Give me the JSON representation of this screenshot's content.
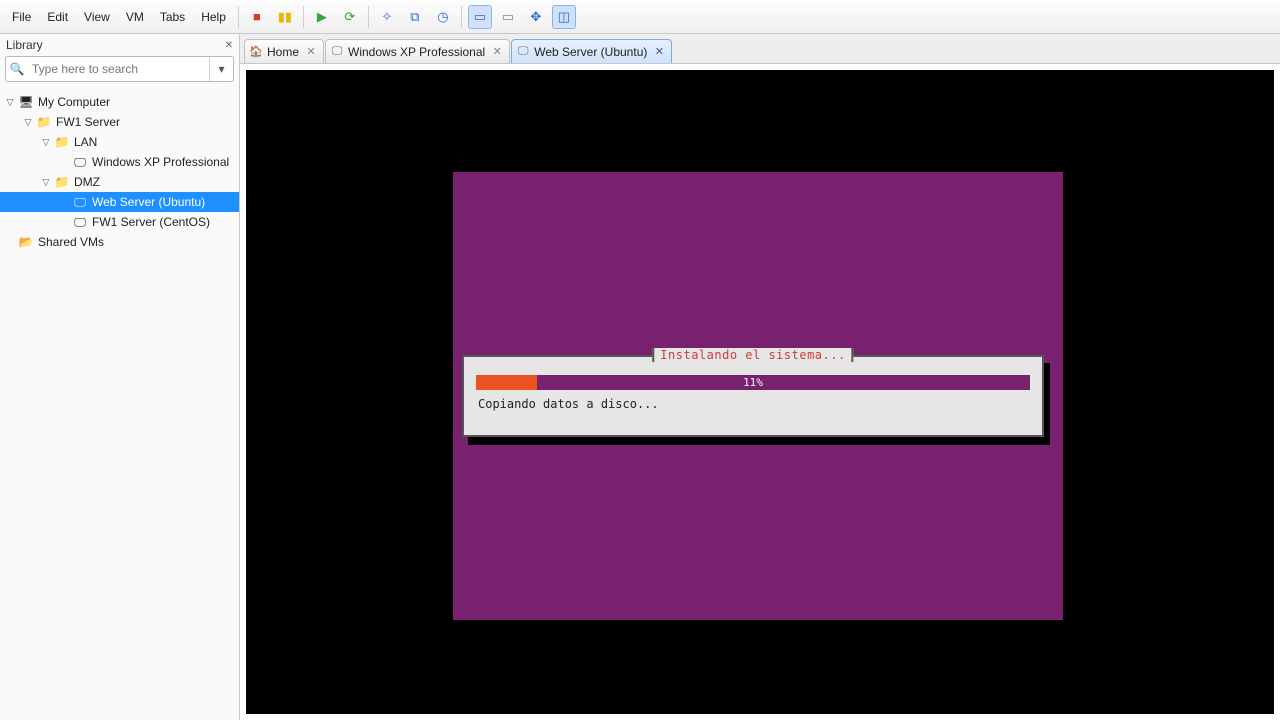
{
  "menu": {
    "file": "File",
    "edit": "Edit",
    "view": "View",
    "vm": "VM",
    "tabs": "Tabs",
    "help": "Help"
  },
  "sidebar": {
    "title": "Library",
    "search_placeholder": "Type here to search",
    "tree": [
      {
        "label": "My Computer",
        "depth": 0,
        "twisty": "▽",
        "icon": "🖥"
      },
      {
        "label": "FW1 Server",
        "depth": 1,
        "twisty": "▽",
        "icon": "📁"
      },
      {
        "label": "LAN",
        "depth": 2,
        "twisty": "▽",
        "icon": "📁"
      },
      {
        "label": "Windows XP Professional",
        "depth": 3,
        "twisty": "",
        "icon": "🖵"
      },
      {
        "label": "DMZ",
        "depth": 2,
        "twisty": "▽",
        "icon": "📁"
      },
      {
        "label": "Web Server (Ubuntu)",
        "depth": 3,
        "twisty": "",
        "icon": "🖵",
        "selected": true
      },
      {
        "label": "FW1 Server (CentOS)",
        "depth": 3,
        "twisty": "",
        "icon": "🖵"
      },
      {
        "label": "Shared VMs",
        "depth": 0,
        "twisty": "",
        "icon": "📂"
      }
    ]
  },
  "tabs": [
    {
      "label": "Home",
      "icon": "🏠",
      "active": false
    },
    {
      "label": "Windows XP Professional",
      "icon": "🖵",
      "active": false
    },
    {
      "label": "Web Server (Ubuntu)",
      "icon": "🖵",
      "active": true
    }
  ],
  "installer": {
    "title": "Instalando el sistema...",
    "pct_text": "11%",
    "pct_value": 11,
    "status": "Copiando datos a disco..."
  }
}
